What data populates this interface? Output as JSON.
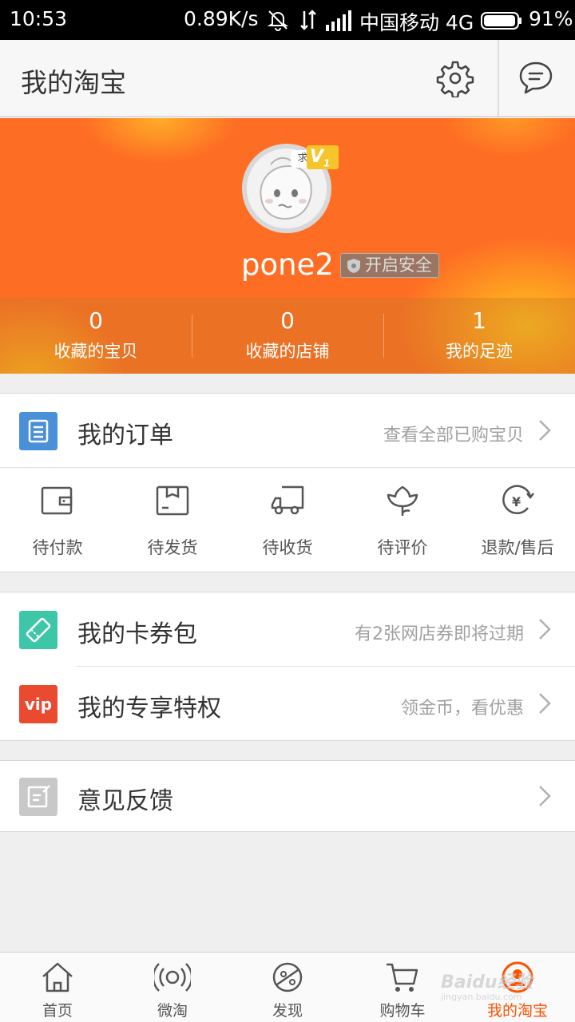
{
  "status_bar": {
    "time": "10:53",
    "net_speed": "0.89K/s",
    "carrier": "中国移动 4G",
    "battery": "91%"
  },
  "header": {
    "title": "我的淘宝",
    "settings_icon": "gear-icon",
    "message_icon": "chat-bubble-icon"
  },
  "profile": {
    "avatar_tag": "求",
    "vip_level": "V",
    "vip_num": "1",
    "username": "pone2",
    "safety_label": "开启安全",
    "stats": [
      {
        "value": "0",
        "label": "收藏的宝贝"
      },
      {
        "value": "0",
        "label": "收藏的店铺"
      },
      {
        "value": "1",
        "label": "我的足迹"
      }
    ]
  },
  "orders": {
    "label": "我的订单",
    "hint": "查看全部已购宝贝",
    "items": [
      {
        "label": "待付款",
        "icon": "wallet-icon"
      },
      {
        "label": "待发货",
        "icon": "box-icon"
      },
      {
        "label": "待收货",
        "icon": "truck-icon"
      },
      {
        "label": "待评价",
        "icon": "flower-icon"
      },
      {
        "label": "退款/售后",
        "icon": "refund-icon"
      }
    ]
  },
  "menu": {
    "coupons": {
      "label": "我的卡券包",
      "hint": "有2张网店券即将过期",
      "color": "#3ec6a8"
    },
    "privileges": {
      "label": "我的专享特权",
      "hint": "领金币，看优惠",
      "badge": "vip",
      "color": "#ea4a2f"
    },
    "feedback": {
      "label": "意见反馈",
      "color": "#c8c8c8"
    }
  },
  "bottom_nav": [
    {
      "label": "首页",
      "icon": "home-icon"
    },
    {
      "label": "微淘",
      "icon": "broadcast-icon"
    },
    {
      "label": "发现",
      "icon": "planet-icon"
    },
    {
      "label": "购物车",
      "icon": "cart-icon"
    },
    {
      "label": "我的淘宝",
      "icon": "profile-icon",
      "active": true
    }
  ],
  "watermark": {
    "text": "Baidu经验",
    "sub": "jingyan.baidu.com"
  },
  "colors": {
    "accent": "#ff5000",
    "banner": "#fe6d24",
    "order_icon": "#4a90d9"
  }
}
